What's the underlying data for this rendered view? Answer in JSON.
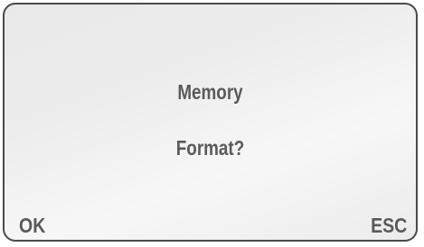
{
  "dialog": {
    "line1": "Memory",
    "line2": "Format?"
  },
  "softkeys": {
    "left_label": "OK",
    "right_label": "ESC"
  },
  "colors": {
    "text": "#5a5a5a",
    "frame_border": "#4a4a4a",
    "screen_background": "#ececec"
  }
}
